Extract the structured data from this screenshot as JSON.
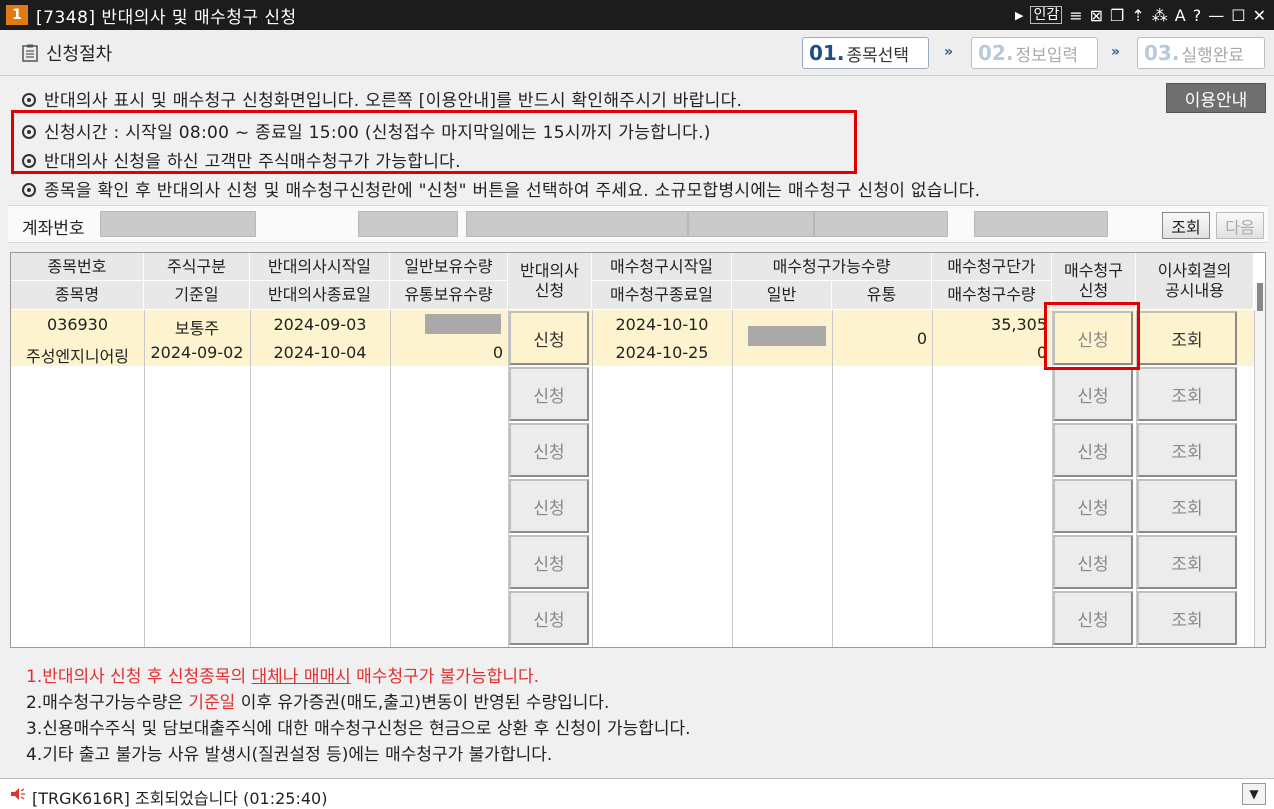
{
  "window": {
    "number": "1",
    "title": "[7348] 반대의사 및 매수청구 신청",
    "tools": [
      "인감",
      "≡",
      "⊠",
      "❐",
      "⇡",
      "⁂",
      "A",
      "?",
      "—",
      "☐",
      "✕"
    ]
  },
  "header": {
    "title": "신청절차",
    "steps": [
      {
        "num": "01.",
        "label": "종목선택"
      },
      {
        "num": "02.",
        "label": "정보입력"
      },
      {
        "num": "03.",
        "label": "실행완료"
      }
    ],
    "arrow": "»"
  },
  "notices": [
    "반대의사 표시 및 매수청구 신청화면입니다. 오른쪽 [이용안내]를 반드시 확인해주시기 바랍니다.",
    "신청시간 : 시작일 08:00 ~ 종료일 15:00 (신청접수 마지막일에는 15시까지 가능합니다.)",
    "반대의사 신청을 하신 고객만 주식매수청구가 가능합니다.",
    "종목을 확인 후 반대의사 신청 및 매수청구신청란에 \"신청\" 버튼을 선택하여 주세요. 소규모합병시에는 매수청구 신청이 없습니다."
  ],
  "guide_button": "이용안내",
  "account": {
    "label": "계좌번호",
    "query_button": "조회",
    "next_button": "다음"
  },
  "table": {
    "headers_top": [
      "종목번호",
      "주식구분",
      "반대의사시작일",
      "일반보유수량",
      "반대의사\n신청",
      "매수청구시작일",
      "매수청구가능수량",
      "매수청구단가",
      "매수청구\n신청",
      "이사회결의\n공시내용"
    ],
    "headers_bottom": [
      "종목명",
      "기준일",
      "반대의사종료일",
      "유통보유수량",
      "매수청구종료일",
      "일반",
      "유통",
      "매수청구수량"
    ],
    "rows": [
      {
        "code": "036930",
        "name": "주성엔지니어링",
        "stock_type": "보통주",
        "base_date": "2024-09-02",
        "oppose_start": "2024-09-03",
        "oppose_end": "2024-10-04",
        "dist_hold_qty": "0",
        "buy_start": "2024-10-10",
        "buy_end": "2024-10-25",
        "buy_qty_dist": "0",
        "buy_price": "35,305",
        "buy_qty": "0"
      }
    ],
    "apply_label": "신청",
    "view_label": "조회",
    "empty_rows": 5
  },
  "notes": {
    "n1_prefix": "1.반대의사 신청 후 신청종목의 ",
    "n1_underline": "대체나 매매시",
    "n1_suffix": " 매수청구가 불가능합니다.",
    "n2_prefix": "2.매수청구가능수량은 ",
    "n2_red": "기준일",
    "n2_suffix": " 이후 유가증권(매도,출고)변동이 반영된 수량입니다.",
    "n3": "3.신용매수주식 및 담보대출주식에 대한 매수청구신청은 현금으로 상환 후 신청이 가능합니다.",
    "n4": "4.기타 출고 불가능 사유 발생시(질권설정 등)에는 매수청구가 불가합니다."
  },
  "status": {
    "text": "[TRGK616R] 조회되었습니다 (01:25:40)"
  },
  "colors": {
    "highlight_row": "#fdf3cf",
    "red_box": "#e00000",
    "note_red": "#e03030",
    "step_active": "#1f4e89"
  }
}
